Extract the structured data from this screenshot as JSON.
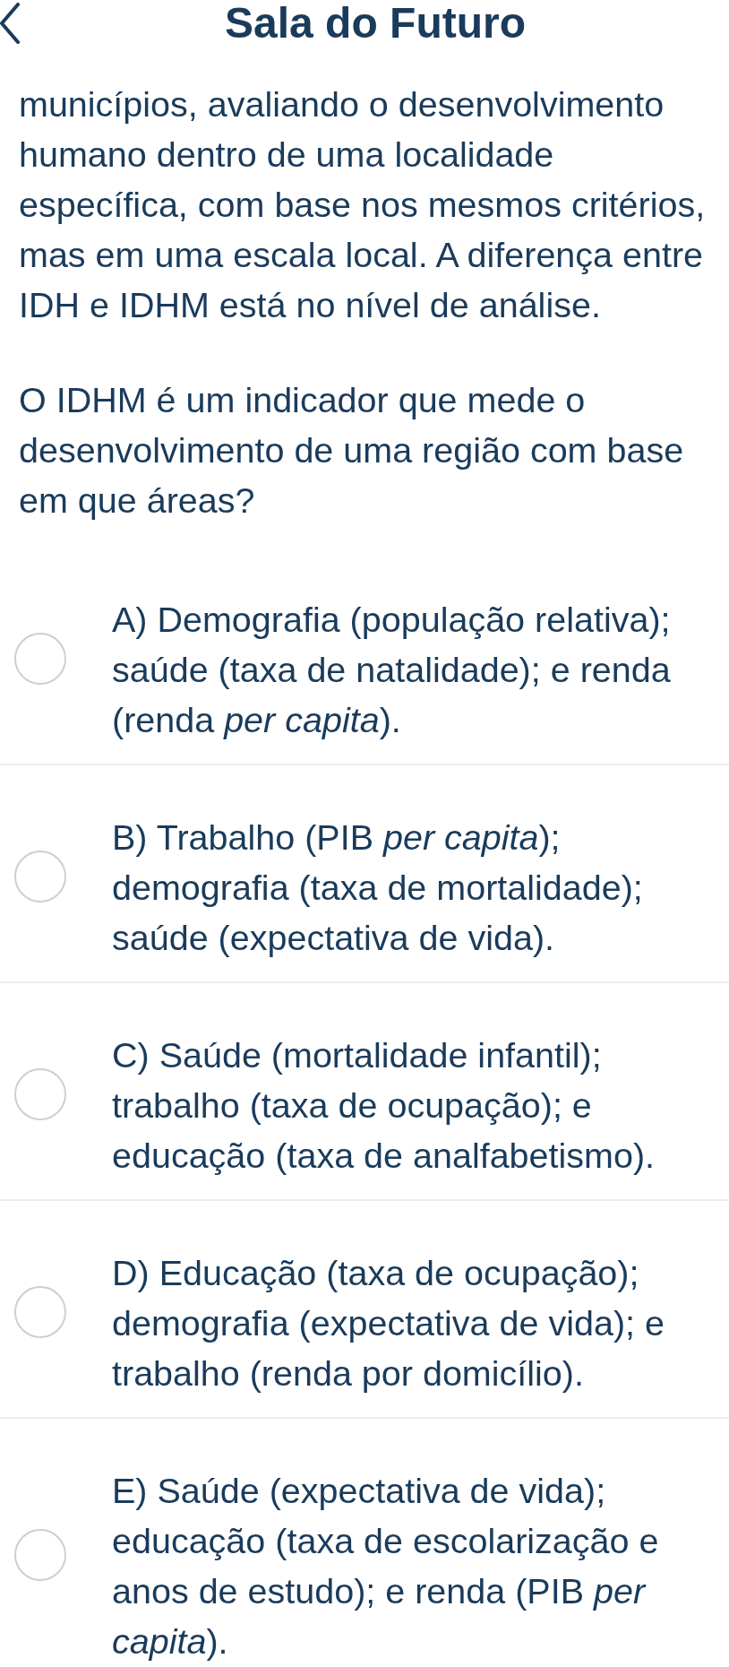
{
  "header": {
    "title": "Sala do Futuro"
  },
  "paragraphs": [
    "municípios, avaliando o desenvolvimento humano dentro de uma localidade específica, com base nos mesmos critérios, mas em uma escala local. A diferença entre IDH e IDHM está no nível de análise.",
    "O IDHM é um indicador que mede o desenvolvimento de uma região com base em que áreas?"
  ],
  "options": [
    {
      "text": "A) Demografia (população relativa); saúde (taxa de natalidade); e renda (renda *per capita*).",
      "selected": false
    },
    {
      "text": "B) Trabalho (PIB *per capita*); demografia (taxa de mortalidade); saúde (expectativa de vida).",
      "selected": false
    },
    {
      "text": "C) Saúde (mortalidade infantil); trabalho (taxa de ocupação); e educação (taxa de analfabetismo).",
      "selected": false
    },
    {
      "text": "D) Educação (taxa de ocupação); demografia (expectativa de vida); e trabalho (renda por domicílio).",
      "selected": false
    },
    {
      "text": "E) Saúde (expectativa de vida); educação (taxa de escolarização e anos de estudo); e renda (PIB *per capita*).",
      "selected": false
    }
  ]
}
